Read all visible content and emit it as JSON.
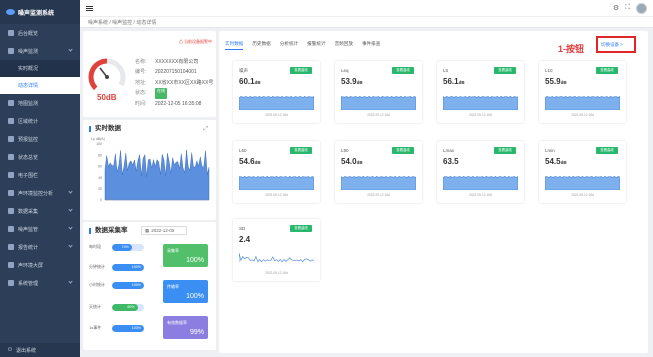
{
  "app": {
    "title": "噪声监测系统"
  },
  "sidebar": {
    "home": "后台概览",
    "monitor": {
      "label": "噪声监测",
      "sub": [
        "实时概况",
        "动态详情"
      ]
    },
    "items": [
      "地图监测",
      "区域统计",
      "预报监控",
      "状态总览",
      "电子围栏",
      "声环境监控分析",
      "数据采集",
      "噪声监管",
      "报告统计",
      "声环境大屏",
      "系统管理"
    ],
    "footer": "退出系统"
  },
  "topbar": {
    "icons": [
      "settings-icon",
      "fullscreen-icon",
      "avatar"
    ]
  },
  "breadcrumb": "噪声系统 / 噪声监控 / 动态详情",
  "device": {
    "alarm_link": "⚠ 当前设备报警中",
    "gauge_value": "50dB",
    "gauge_level": 0.5,
    "rows": [
      {
        "k": "名称:",
        "v": "XXXXXXX有限公司"
      },
      {
        "k": "编号:",
        "v": "202207150104001"
      },
      {
        "k": "地址:",
        "v": "XX省XX市XX区XX路XX号"
      },
      {
        "k": "状态:",
        "v": "在线",
        "tag": true
      },
      {
        "k": "时间:",
        "v": "2022-12-05 16:35:08"
      }
    ]
  },
  "realtime": {
    "title": "实时数据",
    "unit": "Lp dB(A)",
    "y_ticks": [
      "100",
      "80",
      "60",
      "40",
      "20",
      "0"
    ]
  },
  "rate": {
    "title": "数据采集率",
    "date": "2022-12-05",
    "rows": [
      {
        "label": "每时段",
        "pct": 0.62,
        "text": "74%"
      },
      {
        "label": "分钟统计",
        "pct": 1.0,
        "text": "100%"
      },
      {
        "label": "小时统计",
        "pct": 1.0,
        "text": "100%"
      },
      {
        "label": "天统计",
        "pct": 0.8,
        "text": "80%"
      },
      {
        "label": "1s事件",
        "pct": 1.0,
        "text": "100%"
      }
    ],
    "stats": [
      {
        "label": "采集率",
        "value": "100%",
        "color": "#52c06b"
      },
      {
        "label": "传输率",
        "value": "100%",
        "color": "#3b8ff3"
      },
      {
        "label": "有效数据率",
        "value": "99%",
        "color": "#8c7ee0"
      }
    ]
  },
  "main": {
    "tabs": [
      "实时数据",
      "历史数据",
      "分析统计",
      "报警统计",
      "音频回放",
      "事件排查"
    ],
    "group_label": "1-按钮",
    "switch_link": "切换设备 >",
    "badge": "查看曲线",
    "cards": [
      {
        "name": "噪声",
        "value": "60.1",
        "unit": "dB",
        "ts": "2022-09-12 16d"
      },
      {
        "name": "Leq",
        "value": "53.9",
        "unit": "dB",
        "ts": "2022-09-12 16d"
      },
      {
        "name": "L5",
        "value": "56.1",
        "unit": "dB",
        "ts": "2022-09-12 16d"
      },
      {
        "name": "L10",
        "value": "55.9",
        "unit": "dB",
        "ts": "2022-09-12 16d"
      },
      {
        "name": "L50",
        "value": "54.6",
        "unit": "dB",
        "ts": "2022-09-12 16d"
      },
      {
        "name": "L90",
        "value": "54.0",
        "unit": "dB",
        "ts": "2022-09-12 16d"
      },
      {
        "name": "Lmax",
        "value": "63.5",
        "unit": "",
        "ts": "2022-09-12 16d"
      },
      {
        "name": "Lmin",
        "value": "54.5",
        "unit": "dB",
        "ts": "2022-09-12 16d"
      },
      {
        "name": "SD",
        "value": "2.4",
        "unit": "",
        "ts": "2022-09-12 16d"
      }
    ]
  },
  "colors": {
    "accent": "#2d7cf6",
    "danger": "#e02626",
    "ok": "#27b86b",
    "sidebar": "#2c3e58"
  }
}
